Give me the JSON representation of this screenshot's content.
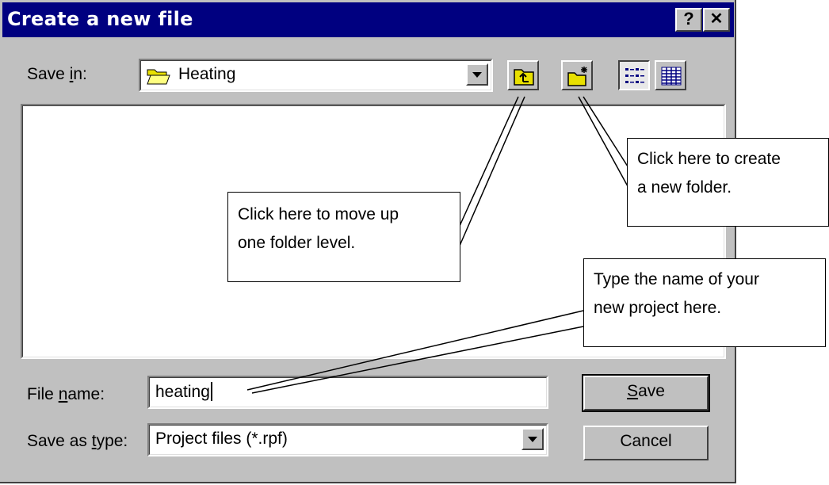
{
  "dialog": {
    "title": "Create a new file",
    "help_label": "?",
    "close_label": "✕"
  },
  "save_in": {
    "label_pre": "Save ",
    "label_accel": "i",
    "label_post": "n:",
    "value": "Heating",
    "icon": "open-folder-icon"
  },
  "toolbar": {
    "up_folder_icon": "up-one-level-icon",
    "new_folder_icon": "new-folder-icon",
    "list_icon": "list-view-icon",
    "details_icon": "details-view-icon"
  },
  "file_name": {
    "label_pre": "File ",
    "label_accel": "n",
    "label_post": "ame:",
    "value": "heating"
  },
  "save_as_type": {
    "label_pre": "Save as ",
    "label_accel": "t",
    "label_post": "ype:",
    "value": "Project files (*.rpf)"
  },
  "buttons": {
    "save_accel": "S",
    "save_rest": "ave",
    "cancel": "Cancel"
  },
  "callouts": {
    "up_folder": [
      "Click here to move up",
      "one folder level."
    ],
    "new_folder": [
      "Click here to create",
      "a new folder."
    ],
    "file_name": [
      "Type the name of your",
      "new project here."
    ]
  }
}
